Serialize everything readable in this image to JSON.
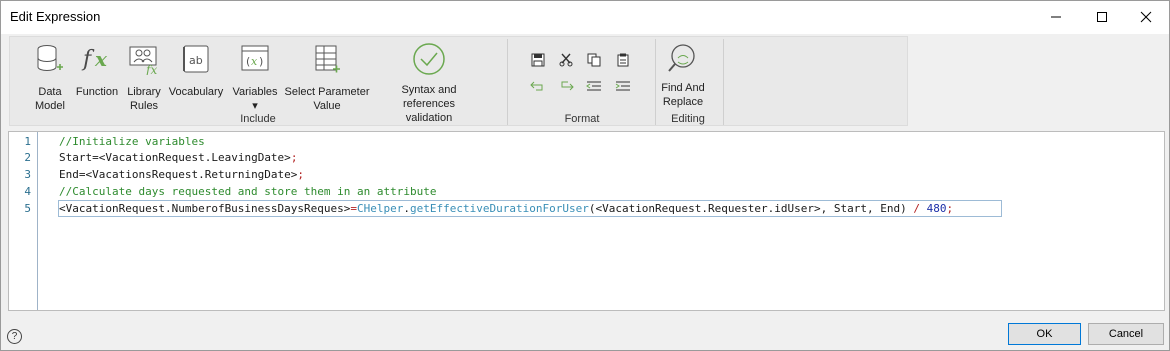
{
  "window": {
    "title": "Edit Expression"
  },
  "ribbon": {
    "include": {
      "label": "Include",
      "buttons": [
        {
          "label": "Data\nModel",
          "icon": "data-model-icon"
        },
        {
          "label": "Function",
          "icon": "function-icon"
        },
        {
          "label": "Library\nRules",
          "icon": "library-rules-icon"
        },
        {
          "label": "Vocabulary",
          "icon": "vocabulary-icon"
        },
        {
          "label": "Variables\n▾",
          "icon": "variables-icon"
        },
        {
          "label": "Select Parameter\nValue",
          "icon": "select-parameter-icon"
        },
        {
          "label": "Syntax and references\nvalidation",
          "icon": "validation-check-icon"
        }
      ]
    },
    "format": {
      "label": "Format",
      "icons": [
        "save-icon",
        "cut-icon",
        "copy-icon",
        "paste-icon",
        "undo-icon",
        "redo-icon",
        "outdent-icon",
        "indent-icon"
      ]
    },
    "editing": {
      "label": "Editing",
      "find_replace": "Find And\nReplace"
    }
  },
  "editor": {
    "line_numbers": [
      "1",
      "2",
      "3",
      "4",
      "5"
    ],
    "lines": [
      {
        "parts": [
          {
            "t": "//Initialize variables",
            "c": "comment"
          }
        ]
      },
      {
        "parts": [
          {
            "t": "Start=",
            "c": "text"
          },
          {
            "t": "<VacationRequest.LeavingDate>",
            "c": "text"
          },
          {
            "t": ";",
            "c": "op"
          }
        ]
      },
      {
        "parts": [
          {
            "t": "End=",
            "c": "text"
          },
          {
            "t": "<VacationsRequest.ReturningDate>",
            "c": "text"
          },
          {
            "t": ";",
            "c": "op"
          }
        ]
      },
      {
        "parts": [
          {
            "t": "//Calculate days requested and store them in an attribute",
            "c": "comment"
          }
        ]
      },
      {
        "parts": [
          {
            "t": "<VacationRequest.NumberofBusinessDaysReques>",
            "c": "text"
          },
          {
            "t": "=",
            "c": "op"
          },
          {
            "t": "CHelper",
            "c": "fn"
          },
          {
            "t": ".",
            "c": "text"
          },
          {
            "t": "getEffectiveDurationForUser",
            "c": "fn"
          },
          {
            "t": "(",
            "c": "text"
          },
          {
            "t": "<VacationRequest.Requester.idUser>",
            "c": "text"
          },
          {
            "t": ", Start, End) ",
            "c": "text"
          },
          {
            "t": "/",
            "c": "op"
          },
          {
            "t": " 480",
            "c": "blue"
          },
          {
            "t": ";",
            "c": "op"
          }
        ]
      }
    ]
  },
  "footer": {
    "help": "?",
    "ok": "OK",
    "cancel": "Cancel"
  }
}
